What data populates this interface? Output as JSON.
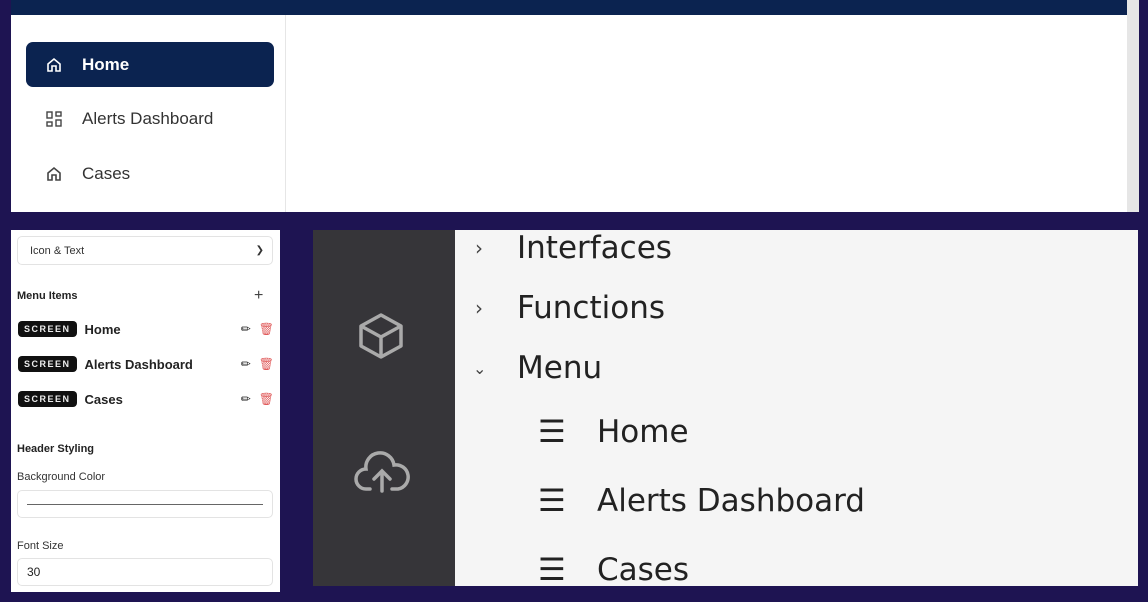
{
  "preview": {
    "nav": [
      {
        "label": "Home",
        "icon": "home-icon",
        "active": true
      },
      {
        "label": "Alerts Dashboard",
        "icon": "grid-icon"
      },
      {
        "label": "Cases",
        "icon": "home-icon"
      }
    ]
  },
  "settings": {
    "display_mode": "Icon & Text",
    "menu_items_title": "Menu Items",
    "items": [
      {
        "type": "SCREEN",
        "name": "Home"
      },
      {
        "type": "SCREEN",
        "name": "Alerts Dashboard"
      },
      {
        "type": "SCREEN",
        "name": "Cases"
      }
    ],
    "header_styling": "Header Styling",
    "bg_color_label": "Background Color",
    "font_size_label": "Font Size",
    "font_size_value": "30",
    "delete_color": "#e05a5a"
  },
  "tree": {
    "nodes": [
      {
        "label": "Interfaces",
        "expanded": false
      },
      {
        "label": "Functions",
        "expanded": false
      },
      {
        "label": "Menu",
        "expanded": true
      }
    ],
    "children": [
      "Home",
      "Alerts Dashboard",
      "Cases"
    ],
    "rail_icons": [
      "cube-icon",
      "cloud-upload-icon"
    ]
  }
}
